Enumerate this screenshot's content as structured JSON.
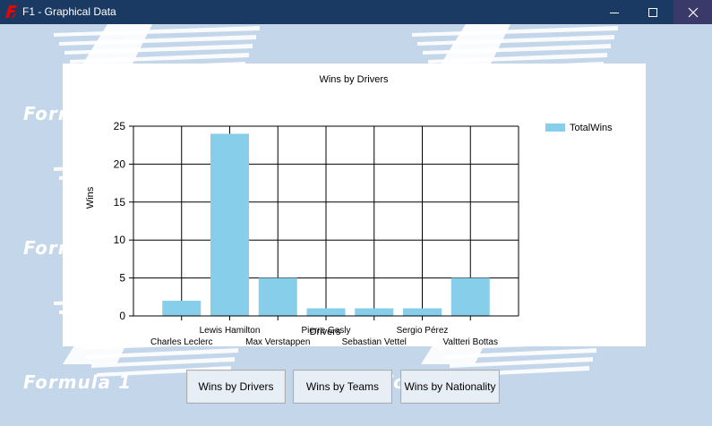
{
  "window": {
    "title": "F1 - Graphical Data",
    "watermark_text": "Formula 1"
  },
  "buttons": {
    "drivers": "Wins by Drivers",
    "teams": "Wins by Teams",
    "nationality": "Wins by Nationality"
  },
  "chart_data": {
    "type": "bar",
    "title": "Wins by Drivers",
    "xlabel": "Drivers",
    "ylabel": "Wins",
    "ylim": [
      0,
      25
    ],
    "yticks": [
      0,
      5,
      10,
      15,
      20,
      25
    ],
    "grid": true,
    "legend_position": "top-right",
    "bar_color": "#87ceeb",
    "categories": [
      "Charles Leclerc",
      "Lewis Hamilton",
      "Max Verstappen",
      "Pierre Gasly",
      "Sebastian Vettel",
      "Sergio Pérez",
      "Valtteri Bottas"
    ],
    "series": [
      {
        "name": "TotalWins",
        "values": [
          2,
          24,
          5,
          1,
          1,
          1,
          5
        ]
      }
    ]
  }
}
